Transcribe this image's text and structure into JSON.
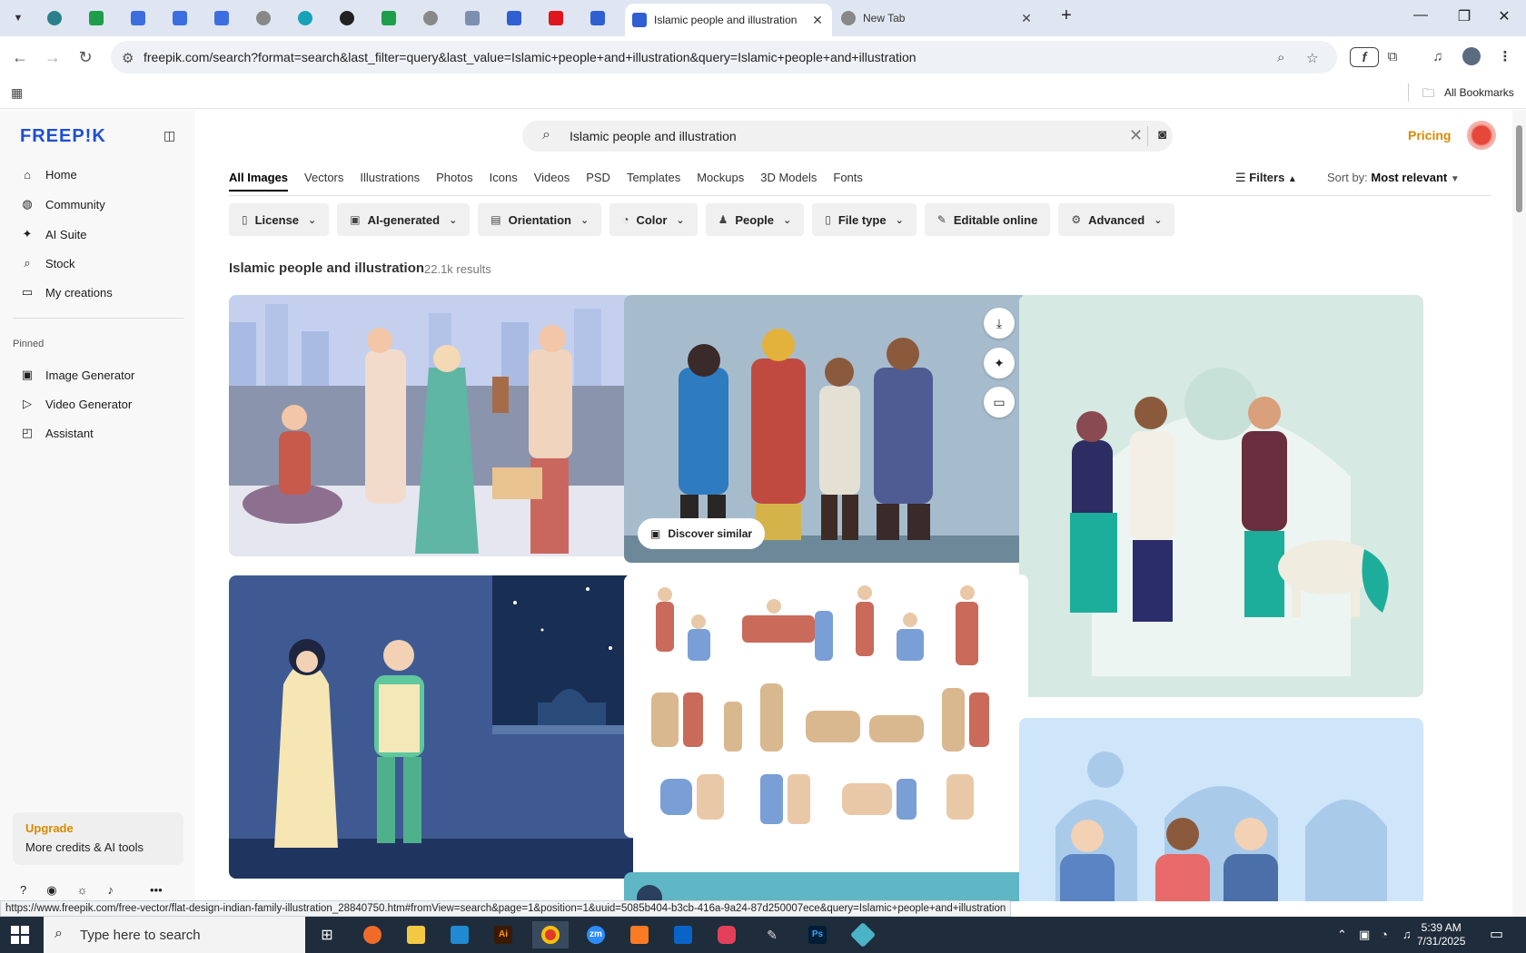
{
  "browser": {
    "active_tab_title": "Islamic people and illustration",
    "other_tab_title": "New Tab",
    "url": "freepik.com/search?format=search&last_filter=query&last_value=Islamic+people+and+illustration&query=Islamic+people+and+illustration",
    "bookmarks_label": "All Bookmarks",
    "status_url": "https://www.freepik.com/free-vector/flat-design-indian-family-illustration_28840750.htm#fromView=search&page=1&position=1&uuid=5085b404-b3cb-416a-9a24-87d250007ece&query=Islamic+people+and+illustration"
  },
  "sidebar": {
    "logo": "FREEP!K",
    "nav": [
      {
        "label": "Home",
        "icon": "home-icon"
      },
      {
        "label": "Community",
        "icon": "globe-icon"
      },
      {
        "label": "AI Suite",
        "icon": "sparkle-icon"
      },
      {
        "label": "Stock",
        "icon": "search-icon"
      },
      {
        "label": "My creations",
        "icon": "folder-icon"
      }
    ],
    "pinned_label": "Pinned",
    "pinned": [
      {
        "label": "Image Generator",
        "icon": "image-icon"
      },
      {
        "label": "Video Generator",
        "icon": "video-icon"
      },
      {
        "label": "Assistant",
        "icon": "chat-icon"
      }
    ],
    "upgrade_title": "Upgrade",
    "upgrade_subtitle": "More credits & AI tools"
  },
  "header": {
    "search_value": "Islamic people and illustration",
    "pricing_label": "Pricing"
  },
  "categories": [
    "All Images",
    "Vectors",
    "Illustrations",
    "Photos",
    "Icons",
    "Videos",
    "PSD",
    "Templates",
    "Mockups",
    "3D Models",
    "Fonts"
  ],
  "filters_label": "Filters",
  "sort": {
    "label": "Sort by:",
    "value": "Most relevant"
  },
  "chips": [
    "License",
    "AI-generated",
    "Orientation",
    "Color",
    "People",
    "File type",
    "Editable online",
    "Advanced"
  ],
  "results": {
    "title": "Islamic people and illustration",
    "count": "22.1k results"
  },
  "card_actions": {
    "discover_label": "Discover similar"
  },
  "taskbar": {
    "search_placeholder": "Type here to search",
    "time": "5:39 AM",
    "date": "7/31/2025"
  },
  "colors": {
    "brand": "#1d4fd6",
    "accent": "#d98a00"
  }
}
